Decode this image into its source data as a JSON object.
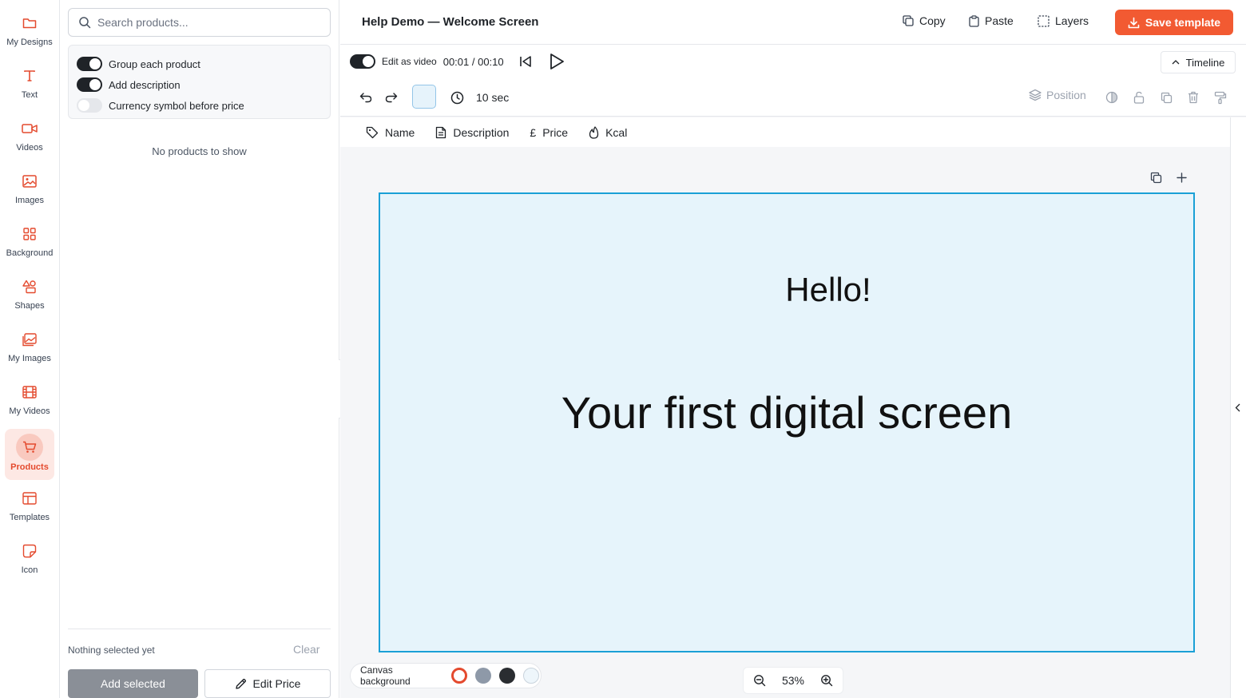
{
  "sidebar": {
    "items": [
      {
        "label": "My Designs",
        "icon": "folder-icon"
      },
      {
        "label": "Text",
        "icon": "text-icon"
      },
      {
        "label": "Videos",
        "icon": "video-camera-icon"
      },
      {
        "label": "Images",
        "icon": "image-icon"
      },
      {
        "label": "Background",
        "icon": "grid-icon"
      },
      {
        "label": "Shapes",
        "icon": "shapes-icon"
      },
      {
        "label": "My Images",
        "icon": "images-stack-icon"
      },
      {
        "label": "My Videos",
        "icon": "film-icon"
      },
      {
        "label": "Products",
        "icon": "cart-icon",
        "active": true
      },
      {
        "label": "Templates",
        "icon": "template-icon"
      },
      {
        "label": "Icon",
        "icon": "sticker-icon"
      }
    ]
  },
  "products_panel": {
    "search_placeholder": "Search products...",
    "options": [
      {
        "label": "Group each product",
        "on": true
      },
      {
        "label": "Add description",
        "on": true
      },
      {
        "label": "Currency symbol before price",
        "on": false
      }
    ],
    "empty_text": "No products to show",
    "selection_text": "Nothing selected yet",
    "clear_label": "Clear",
    "add_selected_label": "Add selected",
    "edit_price_label": "Edit Price"
  },
  "topbar": {
    "title": "Help Demo — Welcome Screen",
    "copy_label": "Copy",
    "paste_label": "Paste",
    "layers_label": "Layers",
    "save_label": "Save template"
  },
  "video_bar": {
    "edit_as_video_label": "Edit as video",
    "edit_as_video_on": true,
    "time_display": "00:01 / 00:10",
    "timeline_label": "Timeline",
    "duration_label": "10 sec",
    "position_label": "Position"
  },
  "fields": [
    {
      "label": "Name",
      "icon": "tag-icon"
    },
    {
      "label": "Description",
      "icon": "document-icon"
    },
    {
      "label": "Price",
      "icon": "pound-icon",
      "prefix": "£"
    },
    {
      "label": "Kcal",
      "icon": "flame-icon"
    }
  ],
  "canvas": {
    "background_color": "#e6f4fb",
    "selection_color": "#1aa0d6",
    "hello_text": "Hello!",
    "headline_text": "Your first digital screen"
  },
  "canvas_background": {
    "label": "Canvas background",
    "swatches": [
      "#ffffff",
      "#8e99a8",
      "#2a2d31",
      "#eef6fb"
    ]
  },
  "zoom": {
    "level": "53%"
  },
  "colors": {
    "accent": "#f25a32",
    "rail_accent": "#e44a2e"
  }
}
